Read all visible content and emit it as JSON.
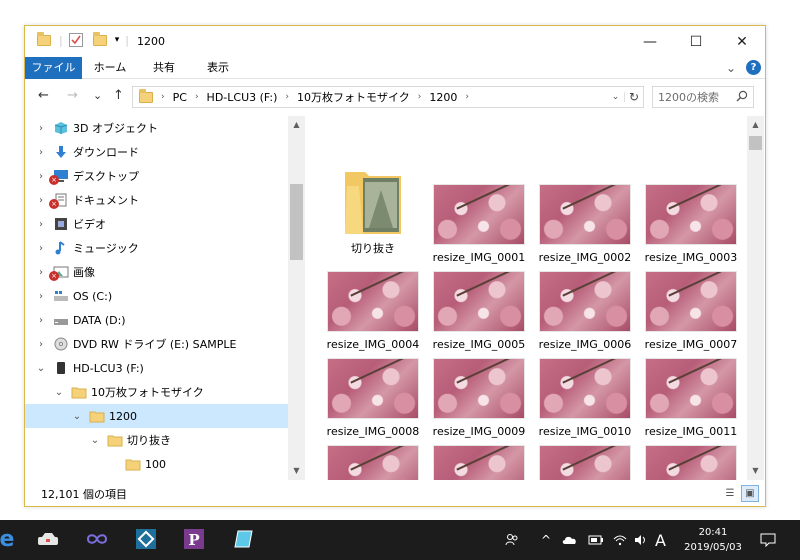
{
  "window": {
    "title": "1200",
    "minimize_glyph": "—",
    "maximize_glyph": "☐",
    "close_glyph": "✕"
  },
  "ribbon": {
    "tabs": [
      "ファイル",
      "ホーム",
      "共有",
      "表示"
    ],
    "help_glyph": "?",
    "expand_glyph": "⌄"
  },
  "nav": {
    "back_glyph": "←",
    "forward_glyph": "→",
    "recent_glyph": "⌄",
    "up_glyph": "↑",
    "address": [
      "PC",
      "HD-LCU3 (F:)",
      "10万枚フォトモザイク",
      "1200"
    ],
    "search_placeholder": "1200の検索",
    "search_glyph": "⚲",
    "refresh_glyph": "↻"
  },
  "tree": [
    {
      "label": "3D オブジェクト",
      "icon": "cube-3d-icon",
      "chevron": "›",
      "level": 0
    },
    {
      "label": "ダウンロード",
      "icon": "download-icon",
      "chevron": "›",
      "level": 0
    },
    {
      "label": "デスクトップ",
      "icon": "desktop-icon",
      "chevron": "›",
      "level": 0,
      "error": true
    },
    {
      "label": "ドキュメント",
      "icon": "document-icon",
      "chevron": "›",
      "level": 0,
      "error": true
    },
    {
      "label": "ビデオ",
      "icon": "video-icon",
      "chevron": "›",
      "level": 0
    },
    {
      "label": "ミュージック",
      "icon": "music-icon",
      "chevron": "›",
      "level": 0
    },
    {
      "label": "画像",
      "icon": "pictures-icon",
      "chevron": "›",
      "level": 0,
      "error": true
    },
    {
      "label": "OS (C:)",
      "icon": "drive-os-icon",
      "chevron": "›",
      "level": 0
    },
    {
      "label": "DATA (D:)",
      "icon": "drive-icon",
      "chevron": "›",
      "level": 0
    },
    {
      "label": "DVD RW ドライブ (E:) SAMPLE",
      "icon": "dvd-icon",
      "chevron": "›",
      "level": 0
    },
    {
      "label": "HD-LCU3 (F:)",
      "icon": "external-drive-icon",
      "chevron": "⌄",
      "level": 0
    },
    {
      "label": "10万枚フォトモザイク",
      "icon": "folder-icon",
      "chevron": "⌄",
      "level": 1
    },
    {
      "label": "1200",
      "icon": "folder-icon",
      "chevron": "⌄",
      "level": 2,
      "selected": true
    },
    {
      "label": "切り抜き",
      "icon": "folder-icon",
      "chevron": "⌄",
      "level": 3
    },
    {
      "label": "100",
      "icon": "folder-icon",
      "chevron": "",
      "level": 4
    }
  ],
  "items": [
    {
      "label": "切り抜き",
      "type": "folder"
    },
    {
      "label": "resize_IMG_0001",
      "type": "image"
    },
    {
      "label": "resize_IMG_0002",
      "type": "image"
    },
    {
      "label": "resize_IMG_0003",
      "type": "image"
    },
    {
      "label": "resize_IMG_0004",
      "type": "image"
    },
    {
      "label": "resize_IMG_0005",
      "type": "image"
    },
    {
      "label": "resize_IMG_0006",
      "type": "image"
    },
    {
      "label": "resize_IMG_0007",
      "type": "image"
    },
    {
      "label": "resize_IMG_0008",
      "type": "image"
    },
    {
      "label": "resize_IMG_0009",
      "type": "image"
    },
    {
      "label": "resize_IMG_0010",
      "type": "image"
    },
    {
      "label": "resize_IMG_0011",
      "type": "image"
    },
    {
      "label": "",
      "type": "image"
    },
    {
      "label": "",
      "type": "image"
    },
    {
      "label": "",
      "type": "image"
    },
    {
      "label": "",
      "type": "image"
    }
  ],
  "status": {
    "item_count": "12,101 個の項目"
  },
  "taskbar": {
    "clock_time": "20:41",
    "clock_date": "2019/05/03",
    "ime_label": "A"
  },
  "colors": {
    "accent": "#1f6fbf",
    "selected_row": "#cce8ff",
    "window_border": "#d8b94a",
    "taskbar": "#1c1c1c"
  }
}
